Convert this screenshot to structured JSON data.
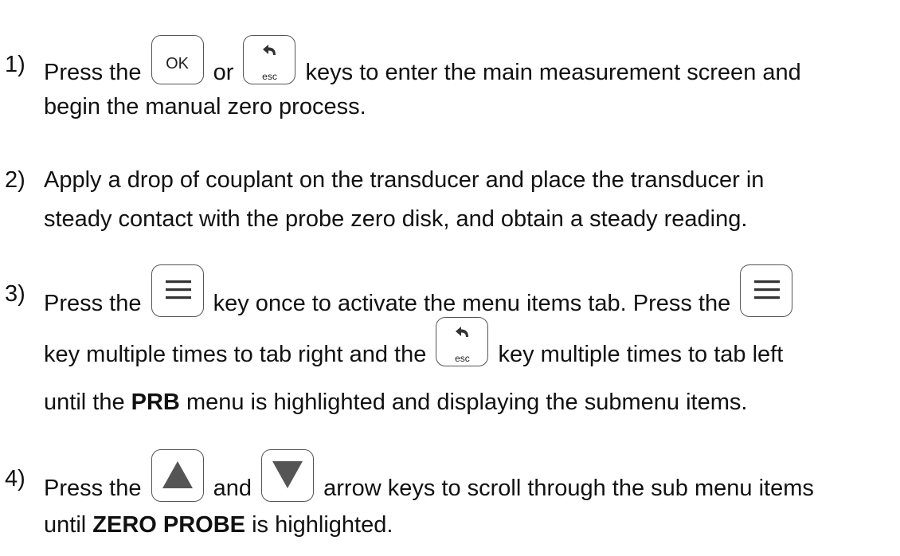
{
  "steps": [
    {
      "number": "1)",
      "line1_a": "Press the",
      "key_ok": "OK",
      "line1_b": "or",
      "key_esc": "esc",
      "line1_c": "keys to enter the main measurement screen and",
      "line2": "begin the manual zero process."
    },
    {
      "number": "2)",
      "line1": "Apply a drop of couplant on the transducer and place the transducer in",
      "line2": "steady contact with the probe zero disk, and obtain a steady reading."
    },
    {
      "number": "3)",
      "line1_a": "Press the",
      "line1_b": "key once to activate the menu items tab.  Press the",
      "line2_a": "key multiple times to tab right and the",
      "key_esc": "esc",
      "line2_b": "key multiple times to tab left",
      "line3_a": "until the",
      "line3_bold": "PRB",
      "line3_b": "menu is highlighted and displaying the submenu items."
    },
    {
      "number": "4)",
      "line1_a": "Press the",
      "line1_b": "and",
      "line1_c": "arrow keys to scroll through the sub menu items",
      "line2_a": "until",
      "line2_bold": "ZERO PROBE",
      "line2_b": "is highlighted."
    }
  ]
}
